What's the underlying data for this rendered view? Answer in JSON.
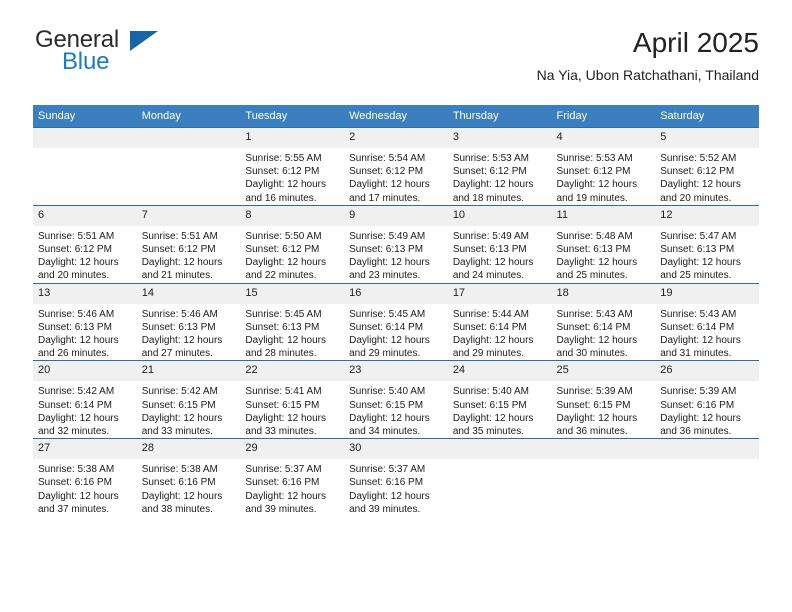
{
  "brand": {
    "name_part1": "General",
    "name_part2": "Blue",
    "accent_color": "#1a7cc4",
    "triangle_color": "#1565a8"
  },
  "header": {
    "title": "April 2025",
    "subtitle": "Na Yia, Ubon Ratchathani, Thailand"
  },
  "calendar": {
    "header_bg": "#3b7fc0",
    "row_divider_color": "#2e6da4",
    "daynum_bg": "#f0f0f0",
    "weekdays": [
      "Sunday",
      "Monday",
      "Tuesday",
      "Wednesday",
      "Thursday",
      "Friday",
      "Saturday"
    ],
    "weeks": [
      [
        {
          "day": "",
          "lines": []
        },
        {
          "day": "",
          "lines": []
        },
        {
          "day": "1",
          "lines": [
            "Sunrise: 5:55 AM",
            "Sunset: 6:12 PM",
            "Daylight: 12 hours",
            "and 16 minutes."
          ]
        },
        {
          "day": "2",
          "lines": [
            "Sunrise: 5:54 AM",
            "Sunset: 6:12 PM",
            "Daylight: 12 hours",
            "and 17 minutes."
          ]
        },
        {
          "day": "3",
          "lines": [
            "Sunrise: 5:53 AM",
            "Sunset: 6:12 PM",
            "Daylight: 12 hours",
            "and 18 minutes."
          ]
        },
        {
          "day": "4",
          "lines": [
            "Sunrise: 5:53 AM",
            "Sunset: 6:12 PM",
            "Daylight: 12 hours",
            "and 19 minutes."
          ]
        },
        {
          "day": "5",
          "lines": [
            "Sunrise: 5:52 AM",
            "Sunset: 6:12 PM",
            "Daylight: 12 hours",
            "and 20 minutes."
          ]
        }
      ],
      [
        {
          "day": "6",
          "lines": [
            "Sunrise: 5:51 AM",
            "Sunset: 6:12 PM",
            "Daylight: 12 hours",
            "and 20 minutes."
          ]
        },
        {
          "day": "7",
          "lines": [
            "Sunrise: 5:51 AM",
            "Sunset: 6:12 PM",
            "Daylight: 12 hours",
            "and 21 minutes."
          ]
        },
        {
          "day": "8",
          "lines": [
            "Sunrise: 5:50 AM",
            "Sunset: 6:12 PM",
            "Daylight: 12 hours",
            "and 22 minutes."
          ]
        },
        {
          "day": "9",
          "lines": [
            "Sunrise: 5:49 AM",
            "Sunset: 6:13 PM",
            "Daylight: 12 hours",
            "and 23 minutes."
          ]
        },
        {
          "day": "10",
          "lines": [
            "Sunrise: 5:49 AM",
            "Sunset: 6:13 PM",
            "Daylight: 12 hours",
            "and 24 minutes."
          ]
        },
        {
          "day": "11",
          "lines": [
            "Sunrise: 5:48 AM",
            "Sunset: 6:13 PM",
            "Daylight: 12 hours",
            "and 25 minutes."
          ]
        },
        {
          "day": "12",
          "lines": [
            "Sunrise: 5:47 AM",
            "Sunset: 6:13 PM",
            "Daylight: 12 hours",
            "and 25 minutes."
          ]
        }
      ],
      [
        {
          "day": "13",
          "lines": [
            "Sunrise: 5:46 AM",
            "Sunset: 6:13 PM",
            "Daylight: 12 hours",
            "and 26 minutes."
          ]
        },
        {
          "day": "14",
          "lines": [
            "Sunrise: 5:46 AM",
            "Sunset: 6:13 PM",
            "Daylight: 12 hours",
            "and 27 minutes."
          ]
        },
        {
          "day": "15",
          "lines": [
            "Sunrise: 5:45 AM",
            "Sunset: 6:13 PM",
            "Daylight: 12 hours",
            "and 28 minutes."
          ]
        },
        {
          "day": "16",
          "lines": [
            "Sunrise: 5:45 AM",
            "Sunset: 6:14 PM",
            "Daylight: 12 hours",
            "and 29 minutes."
          ]
        },
        {
          "day": "17",
          "lines": [
            "Sunrise: 5:44 AM",
            "Sunset: 6:14 PM",
            "Daylight: 12 hours",
            "and 29 minutes."
          ]
        },
        {
          "day": "18",
          "lines": [
            "Sunrise: 5:43 AM",
            "Sunset: 6:14 PM",
            "Daylight: 12 hours",
            "and 30 minutes."
          ]
        },
        {
          "day": "19",
          "lines": [
            "Sunrise: 5:43 AM",
            "Sunset: 6:14 PM",
            "Daylight: 12 hours",
            "and 31 minutes."
          ]
        }
      ],
      [
        {
          "day": "20",
          "lines": [
            "Sunrise: 5:42 AM",
            "Sunset: 6:14 PM",
            "Daylight: 12 hours",
            "and 32 minutes."
          ]
        },
        {
          "day": "21",
          "lines": [
            "Sunrise: 5:42 AM",
            "Sunset: 6:15 PM",
            "Daylight: 12 hours",
            "and 33 minutes."
          ]
        },
        {
          "day": "22",
          "lines": [
            "Sunrise: 5:41 AM",
            "Sunset: 6:15 PM",
            "Daylight: 12 hours",
            "and 33 minutes."
          ]
        },
        {
          "day": "23",
          "lines": [
            "Sunrise: 5:40 AM",
            "Sunset: 6:15 PM",
            "Daylight: 12 hours",
            "and 34 minutes."
          ]
        },
        {
          "day": "24",
          "lines": [
            "Sunrise: 5:40 AM",
            "Sunset: 6:15 PM",
            "Daylight: 12 hours",
            "and 35 minutes."
          ]
        },
        {
          "day": "25",
          "lines": [
            "Sunrise: 5:39 AM",
            "Sunset: 6:15 PM",
            "Daylight: 12 hours",
            "and 36 minutes."
          ]
        },
        {
          "day": "26",
          "lines": [
            "Sunrise: 5:39 AM",
            "Sunset: 6:16 PM",
            "Daylight: 12 hours",
            "and 36 minutes."
          ]
        }
      ],
      [
        {
          "day": "27",
          "lines": [
            "Sunrise: 5:38 AM",
            "Sunset: 6:16 PM",
            "Daylight: 12 hours",
            "and 37 minutes."
          ]
        },
        {
          "day": "28",
          "lines": [
            "Sunrise: 5:38 AM",
            "Sunset: 6:16 PM",
            "Daylight: 12 hours",
            "and 38 minutes."
          ]
        },
        {
          "day": "29",
          "lines": [
            "Sunrise: 5:37 AM",
            "Sunset: 6:16 PM",
            "Daylight: 12 hours",
            "and 39 minutes."
          ]
        },
        {
          "day": "30",
          "lines": [
            "Sunrise: 5:37 AM",
            "Sunset: 6:16 PM",
            "Daylight: 12 hours",
            "and 39 minutes."
          ]
        },
        {
          "day": "",
          "lines": []
        },
        {
          "day": "",
          "lines": []
        },
        {
          "day": "",
          "lines": []
        }
      ]
    ]
  }
}
